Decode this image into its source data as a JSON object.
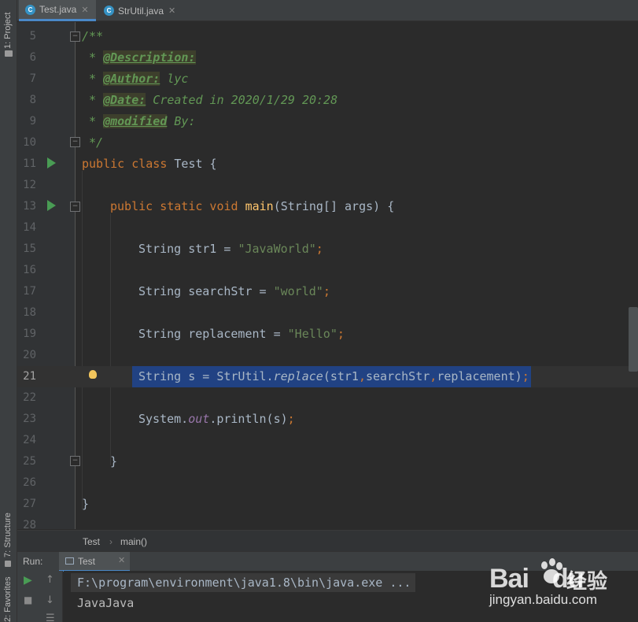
{
  "tool_windows": {
    "project": "1: Project",
    "structure": "7: Structure",
    "favorites": "2: Favorites"
  },
  "tabs": [
    {
      "label": "Test.java",
      "active": true,
      "icon": "java-class-icon"
    },
    {
      "label": "StrUtil.java",
      "active": false,
      "icon": "java-class-icon"
    }
  ],
  "editor": {
    "current_line": 21,
    "lines": [
      {
        "num": "5"
      },
      {
        "num": "6"
      },
      {
        "num": "7"
      },
      {
        "num": "8"
      },
      {
        "num": "9"
      },
      {
        "num": "10"
      },
      {
        "num": "11"
      },
      {
        "num": "12"
      },
      {
        "num": "13"
      },
      {
        "num": "14"
      },
      {
        "num": "15"
      },
      {
        "num": "16"
      },
      {
        "num": "17"
      },
      {
        "num": "18"
      },
      {
        "num": "19"
      },
      {
        "num": "20"
      },
      {
        "num": "21"
      },
      {
        "num": "22"
      },
      {
        "num": "23"
      },
      {
        "num": "24"
      },
      {
        "num": "25"
      },
      {
        "num": "26"
      },
      {
        "num": "27"
      },
      {
        "num": "28"
      }
    ],
    "code": {
      "l5": "/**",
      "l6_star": " * ",
      "l6_tag": "@Description:",
      "l7_star": " * ",
      "l7_tag": "@Author:",
      "l7_text": " lyc",
      "l8_star": " * ",
      "l8_tag": "@Date:",
      "l8_text": " Created in 2020/1/29 20:28",
      "l9_star": " * ",
      "l9_tag": "@modified",
      "l9_text": " By:",
      "l10": " */",
      "l11_kw": "public class ",
      "l11_rest": "Test {",
      "l13_kw": "public static void ",
      "l13_fn": "main",
      "l13_rest": "(String[] args) {",
      "l15_a": "String str1 = ",
      "l15_str": "\"JavaWorld\"",
      "l15_semi": ";",
      "l17_a": "String searchStr = ",
      "l17_str": "\"world\"",
      "l17_semi": ";",
      "l19_a": "String replacement = ",
      "l19_str": "\"Hello\"",
      "l19_semi": ";",
      "l21_a": "String s = StrUtil.",
      "l21_m": "replace",
      "l21_b": "(str1",
      "l21_c1": ",",
      "l21_d": "searchStr",
      "l21_c2": ",",
      "l21_e": "replacement)",
      "l21_semi": ";",
      "l23_a": "System.",
      "l23_out": "out",
      "l23_b": ".println(s)",
      "l23_semi": ";",
      "l25": "}",
      "l27": "}"
    }
  },
  "breadcrumb": {
    "class": "Test",
    "method": "main()",
    "separator": "›"
  },
  "run": {
    "label": "Run:",
    "tab_label": "Test",
    "command": "F:\\program\\environment\\java1.8\\bin\\java.exe ...",
    "output": "JavaJava"
  },
  "watermark": {
    "logo": "Bai",
    "logo2": "du",
    "text": "经验",
    "url": "jingyan.baidu.com"
  },
  "colors": {
    "background": "#2b2b2b",
    "keyword": "#cc7832",
    "string": "#6a8759",
    "comment": "#629755",
    "method": "#ffc66d",
    "static_field": "#9876aa",
    "selection": "#214283",
    "run_green": "#499c54"
  }
}
